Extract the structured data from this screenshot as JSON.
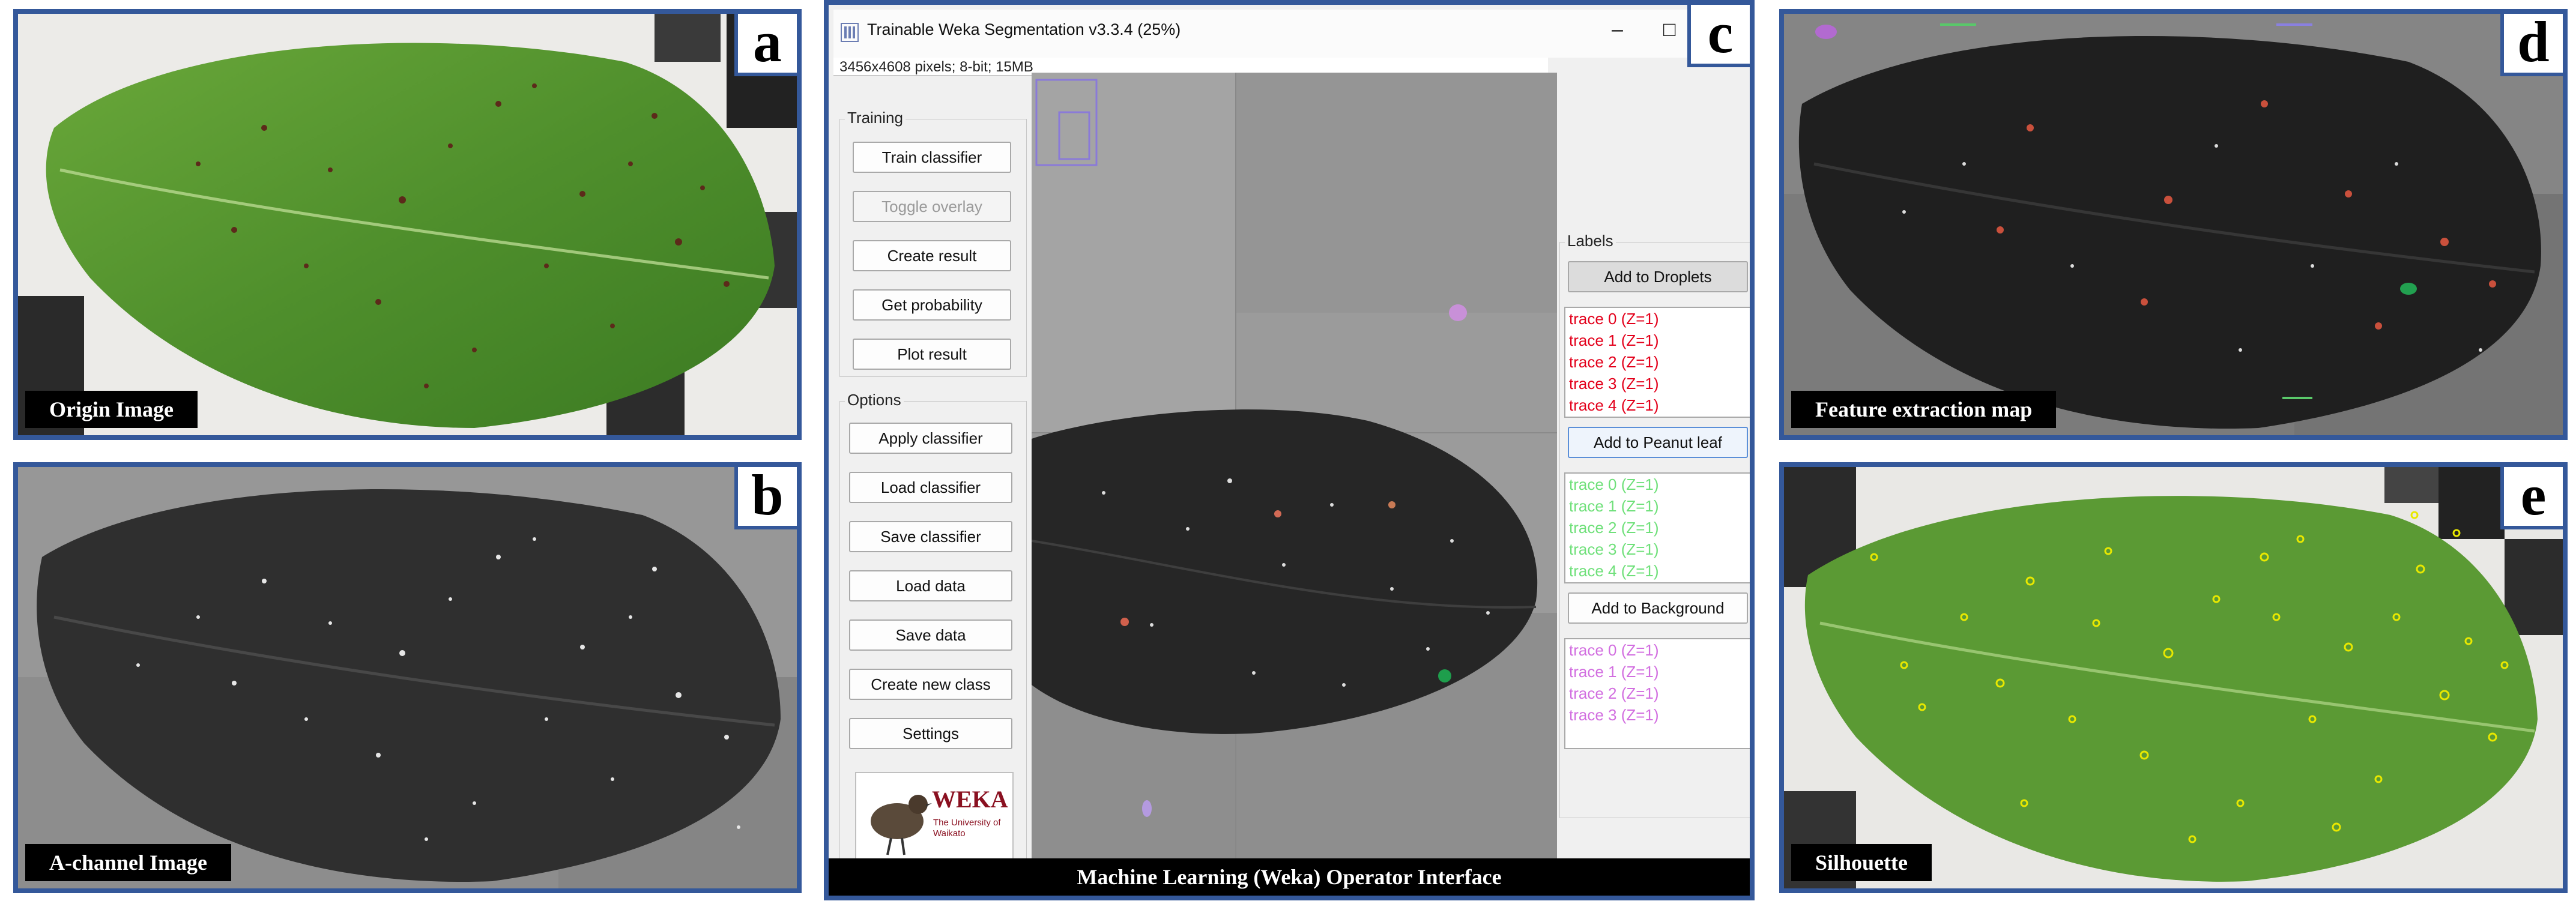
{
  "colors": {
    "frame": "#34589a",
    "droplet_trace": "#e3001b",
    "leaf_trace": "#6fe07a",
    "background_trace": "#d26ee0"
  },
  "panels": {
    "a": {
      "tag": "a",
      "caption": "Origin Image"
    },
    "b": {
      "tag": "b",
      "caption": "A-channel Image"
    },
    "c": {
      "tag": "c",
      "caption": "Machine Learning (Weka) Operator Interface"
    },
    "d": {
      "tag": "d",
      "caption": "Feature extraction map"
    },
    "e": {
      "tag": "e",
      "caption": "Silhouette"
    }
  },
  "weka": {
    "title": "Trainable Weka Segmentation v3.3.4 (25%)",
    "image_info": "3456x4608 pixels; 8-bit; 15MB",
    "window_buttons": [
      "minimize-icon",
      "maximize-icon"
    ],
    "training": {
      "legend": "Training",
      "buttons": [
        {
          "label": "Train classifier",
          "enabled": true
        },
        {
          "label": "Toggle overlay",
          "enabled": false
        },
        {
          "label": "Create result",
          "enabled": true
        },
        {
          "label": "Get probability",
          "enabled": true
        },
        {
          "label": "Plot result",
          "enabled": true
        }
      ]
    },
    "options": {
      "legend": "Options",
      "buttons": [
        "Apply classifier",
        "Load classifier",
        "Save classifier",
        "Load data",
        "Save data",
        "Create new class",
        "Settings"
      ]
    },
    "logo": {
      "text": "WEKA",
      "subtitle": "The University of Waikato"
    },
    "labels": {
      "legend": "Labels",
      "classes": [
        {
          "button": "Add to Droplets",
          "traces": [
            "trace 0 (Z=1)",
            "trace 1 (Z=1)",
            "trace 2 (Z=1)",
            "trace 3 (Z=1)",
            "trace 4 (Z=1)"
          ]
        },
        {
          "button": "Add to Peanut leaf",
          "traces": [
            "trace 0 (Z=1)",
            "trace 1 (Z=1)",
            "trace 2 (Z=1)",
            "trace 3 (Z=1)",
            "trace 4 (Z=1)"
          ]
        },
        {
          "button": "Add to Background",
          "traces": [
            "trace 0 (Z=1)",
            "trace 1 (Z=1)",
            "trace 2 (Z=1)",
            "trace 3 (Z=1)"
          ]
        }
      ]
    }
  }
}
